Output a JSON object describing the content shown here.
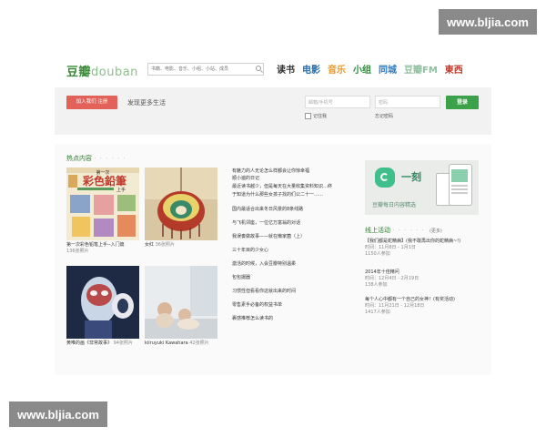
{
  "watermark": {
    "text": "www.bljia.com"
  },
  "header": {
    "logo_cn": "豆瓣",
    "logo_en": "douban",
    "search_placeholder": "书籍、电影、音乐、小组、小站、成员",
    "nav": [
      {
        "label": "读书",
        "color": "#333333"
      },
      {
        "label": "电影",
        "color": "#2a6fb0"
      },
      {
        "label": "音乐",
        "color": "#e89a2a"
      },
      {
        "label": "小组",
        "color": "#2e8f3e"
      },
      {
        "label": "同城",
        "color": "#2d7abf"
      },
      {
        "label": "豆瓣FM",
        "color": "#8fbf9f"
      },
      {
        "label": "東西",
        "color": "#c0392b"
      }
    ]
  },
  "login": {
    "join_label": "加入我们 注册",
    "slogan": "发现更多生活",
    "email_placeholder": "邮箱/手机号",
    "password_placeholder": "密码",
    "login_label": "登录",
    "remember_label": "记住我",
    "forgot_label": "忘记密码"
  },
  "hot": {
    "title": "热点内容",
    "dots": "· · · · · ·",
    "albums": [
      {
        "caption": "第一次彩色铅笔上手--入门篇",
        "count": "136张照片"
      },
      {
        "caption": "女红",
        "count": "36张照片"
      },
      {
        "caption": "黄唯的画《非常故事》",
        "count": "94张照片"
      },
      {
        "caption": "kiiruyuki Kawahara",
        "count": "42张照片"
      }
    ],
    "thumb1_title_line1": "第一次",
    "thumb1_title_line2": "彩色鉛筆",
    "thumb1_title_line3": "上手"
  },
  "articles": [
    "有魅力的人无论怎么样都会让你惊幸福",
    "顺小遍的日记",
    "最近读书越少，但是每天在大量收集资料知识…终",
    "于知道为什么那些女孩子找的们公二十一……",
    "国内最适合出来冬日风景的8条线路",
    "与飞机邻座，一位亿万富翁的对话",
    "我误奏做故事——就在懒家菌（上）",
    "三十年目的少女心",
    "激活的时候，入会豆瓣特别温柔",
    "包包摄器",
    "习惯性但看看你这就出来的时间",
    "零售素手必备的权益书单",
    "裹感推荐怎么读书的"
  ],
  "banner": {
    "title": "一刻",
    "subtitle": "豆瓣每日内容精选"
  },
  "activities": {
    "title": "线上活动",
    "dots": "· · · · · ·",
    "more": "(更多)",
    "items": [
      {
        "title": "【我们都是蛇精病】(我不敢再出你的蛇精病~!)",
        "date": "时间：11月8日 - 1月1日",
        "joined": "1150人参加"
      },
      {
        "title": "2014年十佳精问",
        "date": "时间：12月4日 - 2月19日",
        "joined": "138人参加"
      },
      {
        "title": "每个人心中都有一个自己的女神！(有奖活动)",
        "date": "时间：11月21日 - 12月18日",
        "joined": "1417人参加"
      }
    ]
  }
}
